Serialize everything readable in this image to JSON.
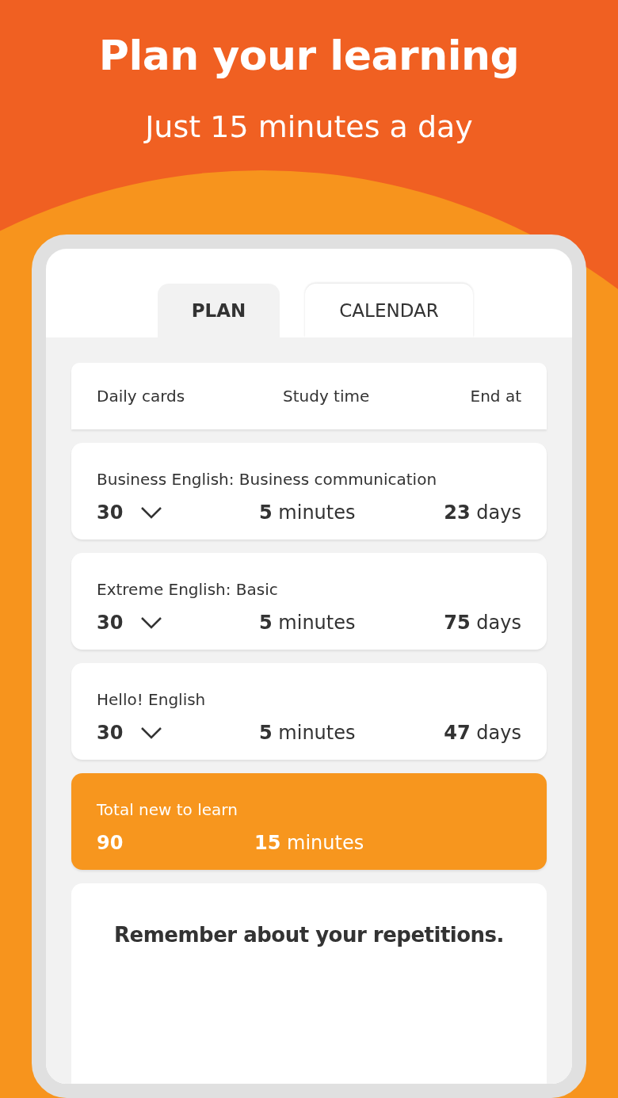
{
  "headline": "Plan your learning",
  "subheadline": "Just 15 minutes a day",
  "tabs": [
    {
      "label": "PLAN",
      "selected": true
    },
    {
      "label": "CALENDAR",
      "selected": false
    }
  ],
  "plan_header": {
    "columns": [
      "Daily cards",
      "Study time",
      "End at"
    ]
  },
  "courses": [
    {
      "name": "Business English: Business communication",
      "daily_cards": "30",
      "study_time": "**5** minutes",
      "end_at": "**23** days"
    },
    {
      "name": "Extreme English: Basic",
      "daily_cards": "30",
      "study_time": "**5** minutes",
      "end_at": "**75** days"
    },
    {
      "name": "Hello! English",
      "daily_cards": "30",
      "study_time": "**5** minutes",
      "end_at": "**47** days"
    }
  ],
  "total": {
    "label": "Total new to learn",
    "cards": "90",
    "study_time": "**15** minutes"
  },
  "reminder": {
    "title": "Remember about your repetitions."
  }
}
